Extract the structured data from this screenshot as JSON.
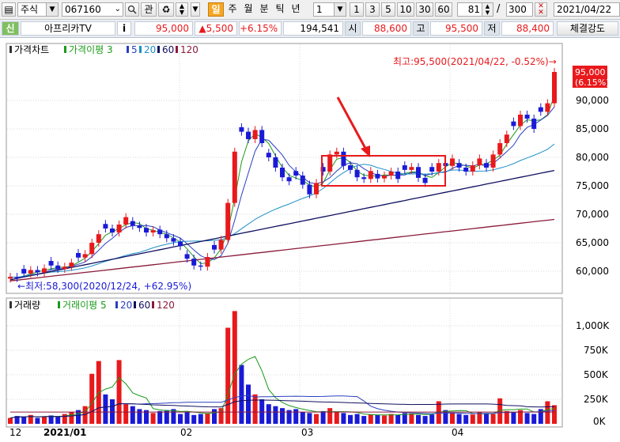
{
  "toolbar": {
    "market": "주식",
    "code": "067160",
    "btn_search_icon": "search-icon",
    "btn_related": "관",
    "period_active": "일",
    "periods": [
      "주",
      "월",
      "분",
      "틱",
      "년"
    ],
    "interval_value": "1",
    "interval_presets": [
      "1",
      "3",
      "5",
      "10",
      "30",
      "60"
    ],
    "count_value": "81",
    "slash": "/",
    "total_value": "300",
    "date_value": "2021/04/22"
  },
  "info": {
    "tag": "신",
    "name": "아프리카TV",
    "info_btn": "i",
    "price": "95,000",
    "change": "▲5,500",
    "change_pct": "+6.15%",
    "volume": "194,541",
    "open_label": "시",
    "open": "88,600",
    "high_label": "고",
    "high": "95,500",
    "low_label": "저",
    "low": "88,400",
    "strength_btn": "체결강도"
  },
  "price_panel": {
    "legend": [
      {
        "text": "가격차트",
        "color": "#000000"
      },
      {
        "text": "가격이평 3",
        "color": "#1a9a1a"
      },
      {
        "text": "5",
        "color": "#2a3fbf"
      },
      {
        "text": "20",
        "color": "#1e90c8"
      },
      {
        "text": "60",
        "color": "#101060"
      },
      {
        "text": "120",
        "color": "#8a1a3a"
      }
    ],
    "yticks": [
      "90,000",
      "85,000",
      "80,000",
      "75,000",
      "70,000",
      "65,000",
      "60,000"
    ],
    "last_price_tag": "95,000",
    "last_pct_tag": "(6.15%)",
    "high_note": "최고:95,500(2021/04/22, -0.52%)→",
    "low_note": "←최저:58,300(2020/12/24, +62.95%)",
    "up_color": "#e8191c",
    "down_color": "#1a1ad6"
  },
  "volume_panel": {
    "legend": [
      {
        "text": "거래량",
        "color": "#000000"
      },
      {
        "text": "거래이평 5",
        "color": "#1a9a1a"
      },
      {
        "text": "20",
        "color": "#2a3fbf"
      },
      {
        "text": "60",
        "color": "#101060"
      },
      {
        "text": "120",
        "color": "#8a1a3a"
      }
    ],
    "yticks": [
      "1,000K",
      "750K",
      "500K",
      "250K",
      "0K"
    ]
  },
  "xaxis": {
    "labels": [
      "12",
      "2021/01",
      "02",
      "03",
      "04"
    ]
  }
}
